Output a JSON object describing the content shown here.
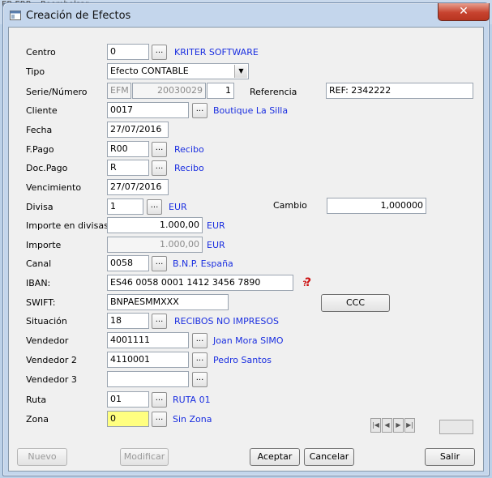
{
  "background": {
    "menu_fragments": [
      "ER ERP",
      "Reembolsar"
    ]
  },
  "window": {
    "title": "Creación de Efectos",
    "close_label": "✕"
  },
  "labels": {
    "centro": "Centro",
    "tipo": "Tipo",
    "serie": "Serie/Número",
    "referencia": "Referencia",
    "cliente": "Cliente",
    "fecha": "Fecha",
    "fpago": "F.Pago",
    "docpago": "Doc.Pago",
    "vencimiento": "Vencimiento",
    "divisa": "Divisa",
    "cambio": "Cambio",
    "importe_divisas": "Importe en divisas",
    "importe": "Importe",
    "canal": "Canal",
    "iban": "IBAN:",
    "swift": "SWIFT:",
    "situacion": "Situación",
    "vendedor": "Vendedor",
    "vendedor2": "Vendedor 2",
    "vendedor3": "Vendedor 3",
    "ruta": "Ruta",
    "zona": "Zona"
  },
  "fields": {
    "centro": "0",
    "tipo": "Efecto CONTABLE",
    "serie": "EFM",
    "numero": "20030029",
    "numero_suffix": "1",
    "referencia": "REF: 2342222",
    "cliente": "0017",
    "fecha": "27/07/2016",
    "fpago": "R00",
    "docpago": "R",
    "vencimiento": "27/07/2016",
    "divisa": "1",
    "cambio": "1,000000",
    "importe_divisas": "1.000,00",
    "importe": "1.000,00",
    "canal": "0058",
    "iban": "ES46 0058 0001 1412 3456 7890",
    "swift": "BNPAESMMXXX",
    "situacion": "18",
    "vendedor": "4001111",
    "vendedor2": "4110001",
    "vendedor3": "",
    "ruta": "01",
    "zona": "0"
  },
  "descriptions": {
    "centro": "KRITER SOFTWARE",
    "cliente": "Boutique La Silla",
    "fpago": "Recibo",
    "docpago": "Recibo",
    "divisa": "EUR",
    "importe_divisas": "EUR",
    "importe": "EUR",
    "canal": "B.N.P. España",
    "situacion": "RECIBOS NO IMPRESOS",
    "vendedor": "Joan Mora SIMO",
    "vendedor2": "Pedro Santos",
    "ruta": "RUTA 01",
    "zona": "Sin Zona"
  },
  "buttons": {
    "lookup": "...",
    "ccc": "CCC",
    "nuevo": "Nuevo",
    "modificar": "Modificar",
    "aceptar": "Aceptar",
    "cancelar": "Cancelar",
    "salir": "Salir"
  },
  "icons": {
    "window": "app-window-icon",
    "iban_status": "help-question-icon",
    "dropdown": "chevron-down-icon",
    "nav": [
      "first-record-icon",
      "previous-record-icon",
      "next-record-icon",
      "last-record-icon"
    ]
  },
  "colors": {
    "link": "#1a2ee0",
    "zona_highlight": "#ffff80",
    "iban_icon": "#cc1111",
    "close": "#c7432f"
  }
}
